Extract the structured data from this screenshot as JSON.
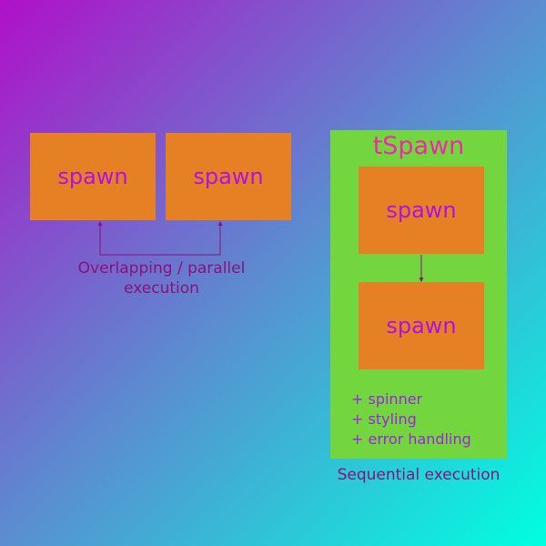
{
  "parallel": {
    "box_left_label": "spawn",
    "box_right_label": "spawn",
    "caption_line1": "Overlapping / parallel",
    "caption_line2": "execution"
  },
  "sequential": {
    "panel_title": "tSpawn",
    "box_top_label": "spawn",
    "box_bottom_label": "spawn",
    "features": [
      "+ spinner",
      "+ styling",
      "+ error handling"
    ],
    "caption": "Sequential execution"
  },
  "colors": {
    "box_fill": "#e58025",
    "box_text": "#b011e0",
    "panel_fill": "#74d63f",
    "panel_title": "#ee2aa8",
    "caption_text": "#86147a",
    "connector": "#86147a"
  }
}
